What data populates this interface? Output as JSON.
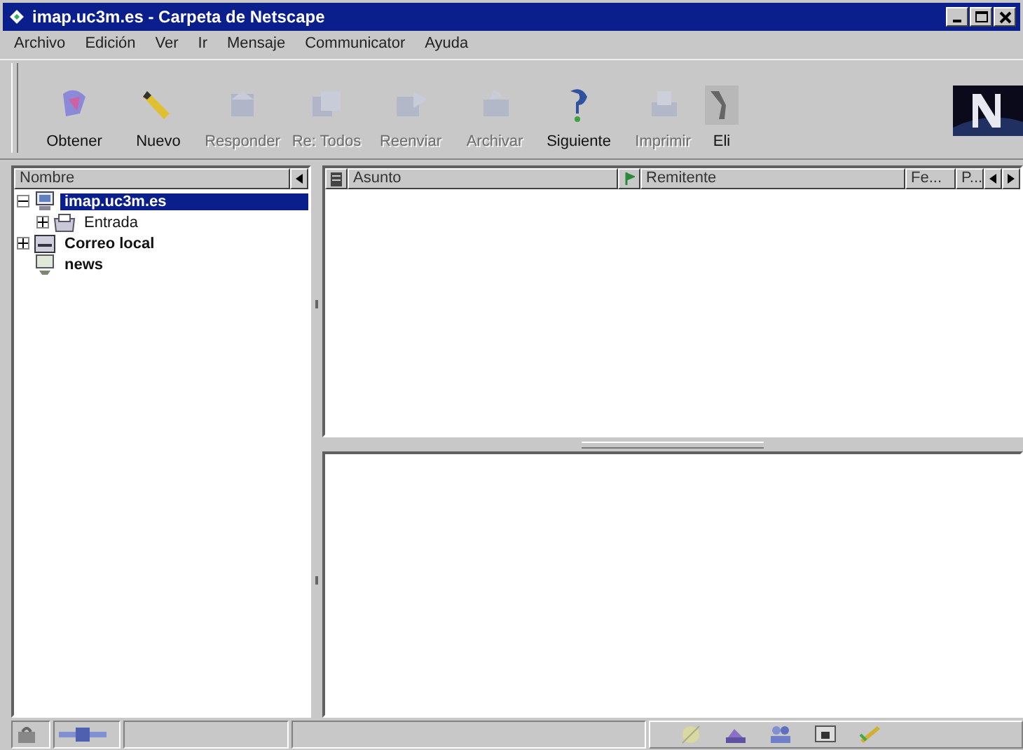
{
  "window": {
    "title": "imap.uc3m.es - Carpeta de Netscape"
  },
  "menu": [
    "Archivo",
    "Edición",
    "Ver",
    "Ir",
    "Mensaje",
    "Communicator",
    "Ayuda"
  ],
  "toolbar": [
    {
      "label": "Obtener",
      "disabled": false,
      "kind": "get"
    },
    {
      "label": "Nuevo",
      "disabled": false,
      "kind": "new"
    },
    {
      "label": "Responder",
      "disabled": true,
      "kind": "reply"
    },
    {
      "label": "Re: Todos",
      "disabled": true,
      "kind": "replyall"
    },
    {
      "label": "Reenviar",
      "disabled": true,
      "kind": "forward"
    },
    {
      "label": "Archivar",
      "disabled": true,
      "kind": "file"
    },
    {
      "label": "Siguiente",
      "disabled": false,
      "kind": "next"
    },
    {
      "label": "Imprimir",
      "disabled": true,
      "kind": "print"
    },
    {
      "label": "Eli",
      "disabled": false,
      "kind": "delete"
    }
  ],
  "folders": {
    "column": "Nombre",
    "items": [
      {
        "label": "imap.uc3m.es",
        "kind": "server",
        "selected": true,
        "expanded": true,
        "children": [
          {
            "label": "Entrada",
            "kind": "inbox",
            "selected": false,
            "expanded": false
          }
        ]
      },
      {
        "label": "Correo local",
        "kind": "local",
        "selected": false,
        "expanded": false
      },
      {
        "label": "news",
        "kind": "news",
        "selected": false
      }
    ]
  },
  "messages": {
    "columns": [
      {
        "label": "Asunto"
      },
      {
        "label": "Remitente"
      },
      {
        "label": "Fe..."
      },
      {
        "label": "P..."
      }
    ]
  }
}
